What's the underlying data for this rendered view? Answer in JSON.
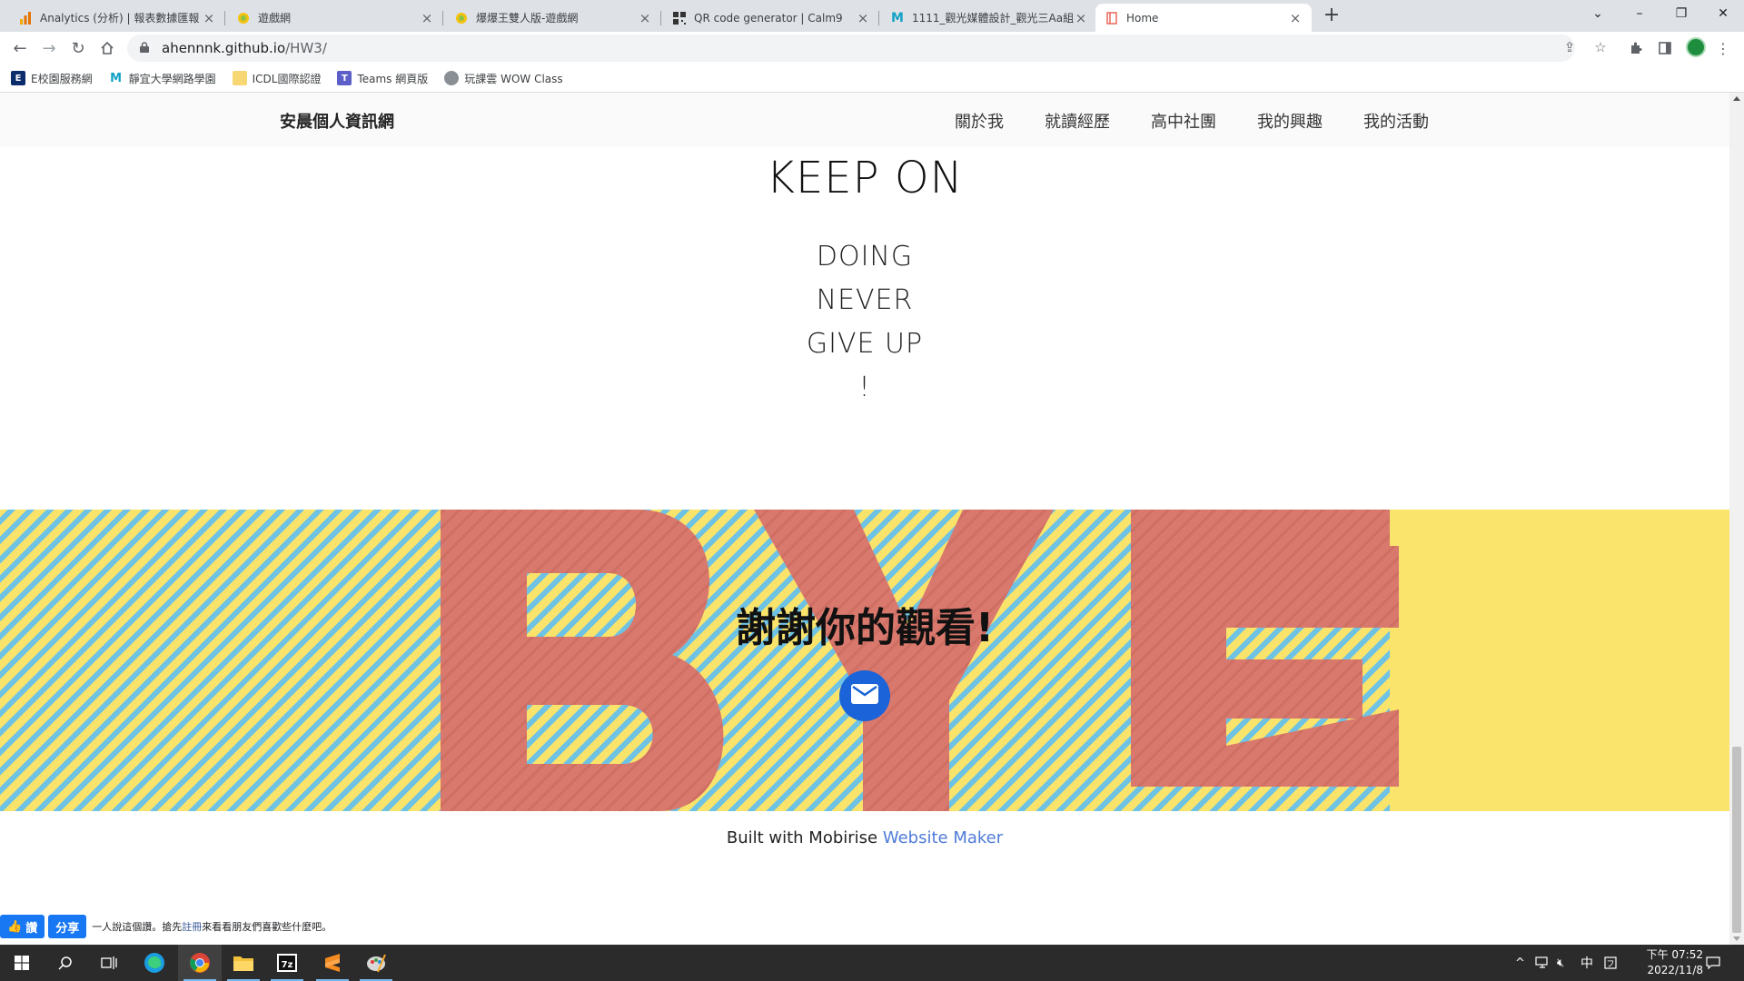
{
  "browser": {
    "tabs": [
      {
        "title": "Analytics (分析) | 報表數據匯報",
        "icon": "analytics-icon"
      },
      {
        "title": "遊戲網",
        "icon": "game-site-icon"
      },
      {
        "title": "爆爆王雙人版-遊戲網",
        "icon": "game-site-icon"
      },
      {
        "title": "QR code generator | Calm9",
        "icon": "qr-icon"
      },
      {
        "title": "1111_觀光媒體設計_觀光三Aa組",
        "icon": "m-icon"
      },
      {
        "title": "Home",
        "icon": "page-icon"
      }
    ],
    "new_tab": "+",
    "url_domain": "ahennnk.github.io",
    "url_path": "/HW3/",
    "bookmarks": [
      "E校園服務網",
      "靜宜大學網路學園",
      "ICDL國際認證",
      "Teams 網頁版",
      "玩課雲 WOW Class"
    ],
    "controls": {
      "minimize": "–",
      "restore": "❐",
      "close": "✕",
      "dropdown": "⌄"
    }
  },
  "site": {
    "brand": "安晨個人資訊網",
    "nav": [
      "關於我",
      "就讀經歷",
      "高中社團",
      "我的興趣",
      "我的活動"
    ],
    "hero_title": "KEEP ON",
    "lines": [
      "DOING",
      "NEVER",
      "GIVE  UP",
      "!"
    ],
    "bye_word": "BYE",
    "thanks": "謝謝你的觀看!",
    "footer_prefix": "Built with Mobirise ",
    "footer_link": "Website Maker",
    "fb": {
      "like": "讚",
      "share": "分享",
      "text_a": "一人說這個讚。搶先",
      "register": "註冊",
      "text_b": "來看看朋友們喜歡些什麼吧。"
    }
  },
  "colors": {
    "stripe_yellow": "#f9e36b",
    "stripe_blue": "#6ec3e4",
    "letter_red": "#d9786c",
    "mail_blue": "#1a63d8",
    "link_blue": "#4f7bd8"
  },
  "taskbar": {
    "time": "下午 07:52",
    "date": "2022/11/8",
    "ime": "中"
  }
}
